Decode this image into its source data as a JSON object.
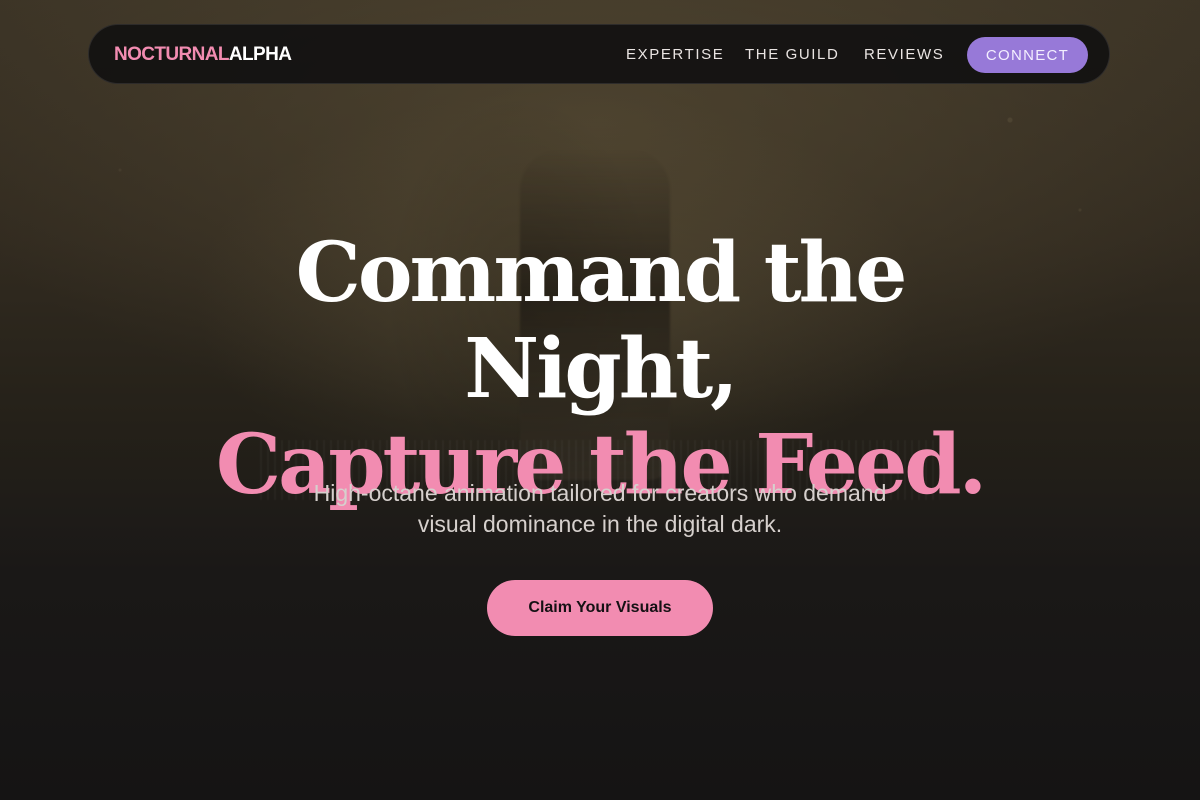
{
  "brand": {
    "first": "NOCTURNAL",
    "second": "ALPHA"
  },
  "nav": {
    "items": [
      {
        "label": "EXPERTISE"
      },
      {
        "label": "THE GUILD"
      },
      {
        "label": "REVIEWS"
      }
    ],
    "connect_label": "CONNECT"
  },
  "hero": {
    "headline_line1": "Command the",
    "headline_line2": "Night,",
    "headline_line3": "Capture the Feed.",
    "subheadline_line1": "High-octane animation tailored for creators who demand",
    "subheadline_line2": "visual dominance in the digital dark.",
    "cta_label": "Claim Your Visuals"
  },
  "colors": {
    "accent_pink": "#f28cb1",
    "accent_purple": "#9779d8",
    "background_dark": "#151414",
    "text_white": "#ffffff"
  }
}
